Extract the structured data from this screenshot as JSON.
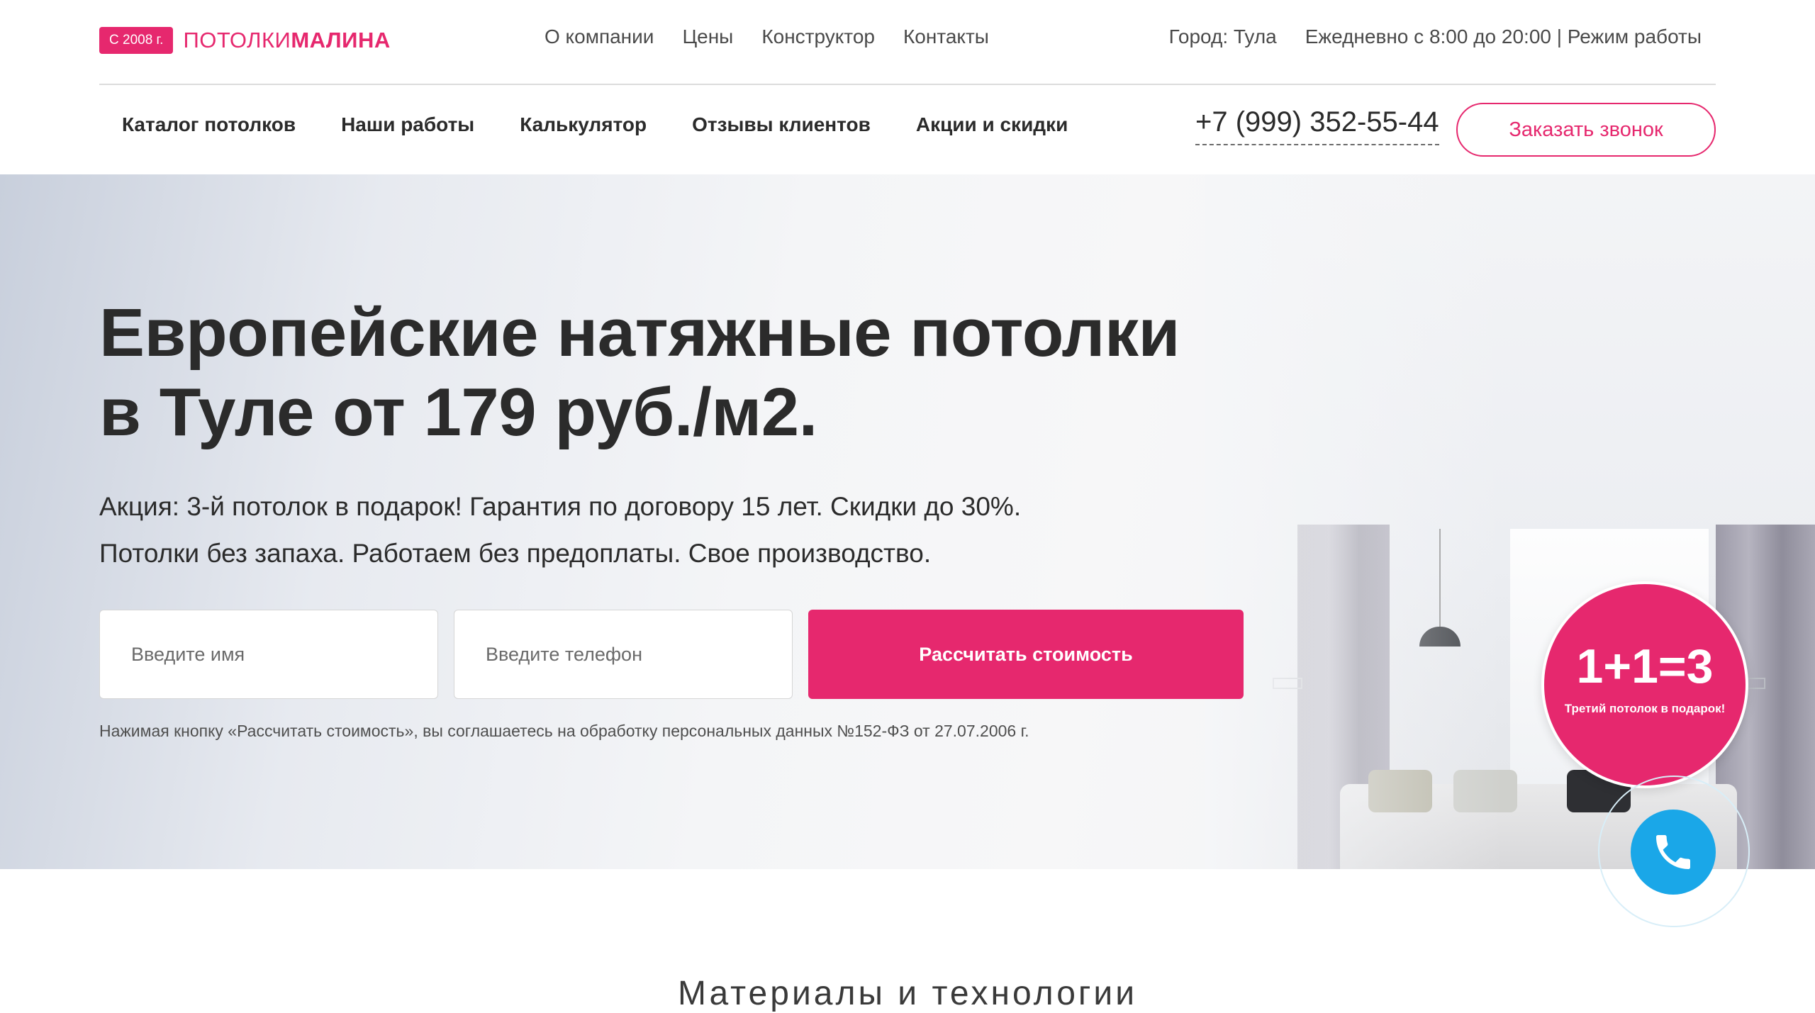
{
  "header": {
    "logo_badge": "С 2008 г.",
    "logo_text_plain": "ПОТОЛКИ",
    "logo_text_bold": "МАЛИНА",
    "top_nav": [
      "О компании",
      "Цены",
      "Конструктор",
      "Контакты"
    ],
    "city": "Город: Тула",
    "hours": "Ежедневно с 8:00 до 20:00 | Режим работы",
    "main_nav": [
      "Каталог потолков",
      "Наши работы",
      "Калькулятор",
      "Отзывы клиентов",
      "Акции и скидки"
    ],
    "phone": "+7 (999) 352-55-44",
    "callback_label": "Заказать звонок"
  },
  "hero": {
    "title_line1": "Европейские натяжные потолки",
    "title_line2": "в Туле от 179 руб./м2.",
    "line1": "Акция: 3-й потолок в подарок! Гарантия по договору 15 лет. Скидки до 30%.",
    "line2": "Потолки без запаха. Работаем без предоплаты. Свое производство.",
    "name_placeholder": "Введите имя",
    "phone_placeholder": "Введите телефон",
    "submit_label": "Рассчитать стоимость",
    "disclaimer": "Нажимая кнопку «Рассчитать стоимость», вы соглашаетесь на обработку персональных данных №152-ФЗ от 27.07.2006 г."
  },
  "promo": {
    "big": "1+1=3",
    "small": "Третий потолок в подарок!"
  },
  "call_widget": {
    "icon": "phone-icon"
  },
  "section": {
    "title": "Материалы и технологии"
  },
  "colors": {
    "accent": "#e6286e",
    "call": "#1aa7e8",
    "text": "#2b2b2b"
  }
}
